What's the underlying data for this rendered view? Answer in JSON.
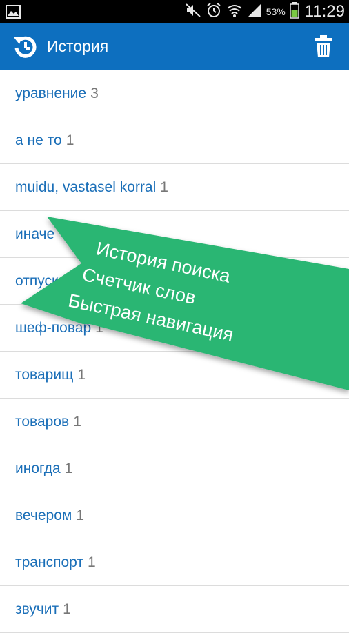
{
  "status_bar": {
    "battery_percent": "53%",
    "time": "11:29",
    "icons": [
      "image-icon",
      "mute-icon",
      "alarm-icon",
      "wifi-icon",
      "signal-icon",
      "battery-icon"
    ]
  },
  "action_bar": {
    "title": "История",
    "background": "#0d6fbf",
    "icons": [
      "history-icon",
      "trash-icon"
    ]
  },
  "history": [
    {
      "word": "уравнение",
      "count": "3"
    },
    {
      "word": "а не то",
      "count": "1"
    },
    {
      "word": "muidu, vastasel korral",
      "count": "1"
    },
    {
      "word": "иначе",
      "count": ""
    },
    {
      "word": "отпуск",
      "count": ""
    },
    {
      "word": "шеф-повар",
      "count": "1"
    },
    {
      "word": "товарищ",
      "count": "1"
    },
    {
      "word": "товаров",
      "count": "1"
    },
    {
      "word": "иногда",
      "count": "1"
    },
    {
      "word": "вечером",
      "count": "1"
    },
    {
      "word": "транспорт",
      "count": "1"
    },
    {
      "word": "звучит",
      "count": "1"
    }
  ],
  "banner": {
    "lines": [
      "История поиска",
      "Счетчик слов",
      "Быстрая навигация"
    ],
    "color": "#2bb673"
  }
}
